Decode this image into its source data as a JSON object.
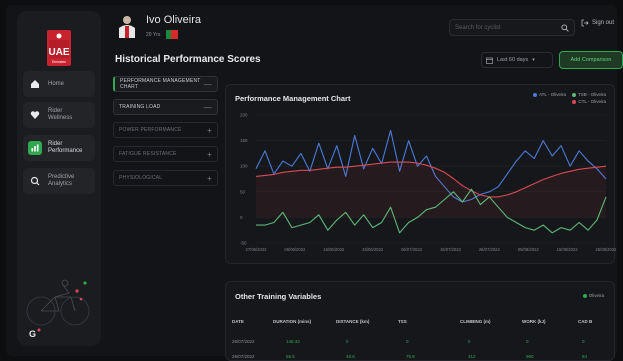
{
  "athlete": {
    "name": "Ivo Oliveira",
    "age": "20 Yrs"
  },
  "search": {
    "placeholder": "Search for cyclist"
  },
  "header": {
    "sign_out": "Sign out"
  },
  "sidebar": {
    "logo_text": "UAE",
    "logo_sub": "Emirates",
    "items": [
      {
        "label": "Home",
        "icon": "home-icon"
      },
      {
        "label": "Rider\nWellness",
        "icon": "heart-icon"
      },
      {
        "label": "Rider\nPerformance",
        "icon": "chart-icon"
      },
      {
        "label": "Predictive\nAnalytics",
        "icon": "analytics-icon"
      }
    ],
    "footer_logo": "G"
  },
  "page": {
    "title": "Historical Performance Scores",
    "range": "Last 60 days",
    "add_button": "Add Comparison"
  },
  "metrics": [
    {
      "label": "PERFORMANCE MANAGEMENT CHART",
      "toggle": "—"
    },
    {
      "label": "TRAINING LOAD",
      "toggle": "—"
    },
    {
      "label": "POWER PERFORMANCE",
      "toggle": "+"
    },
    {
      "label": "FATIGUE RESISTANCE",
      "toggle": "+"
    },
    {
      "label": "PHYSIOLOGICAL",
      "toggle": "+"
    }
  ],
  "chart": {
    "title": "Performance Management Chart",
    "legend": [
      {
        "name": "ATL - Oliveira",
        "color": "#4c7bd9"
      },
      {
        "name": "TSB - Oliveira",
        "color": "#5db87a"
      },
      {
        "name": "CTL - Oliveira",
        "color": "#d94a57"
      }
    ]
  },
  "chart_data": {
    "type": "line",
    "title": "Performance Management Chart",
    "ylim": [
      -50,
      200
    ],
    "yticks": [
      200,
      150,
      100,
      50,
      0,
      -50
    ],
    "x_ticks": [
      "27/05/2022",
      "06/06/2022",
      "16/06/2022",
      "26/06/2022",
      "06/07/2022",
      "16/07/2022",
      "26/07/2022",
      "05/08/2022",
      "15/08/2022",
      "25/08/2022"
    ],
    "series": [
      {
        "name": "ATL - Oliveira",
        "color": "#4c7bd9",
        "values": [
          95,
          130,
          85,
          110,
          100,
          125,
          90,
          145,
          95,
          140,
          80,
          160,
          95,
          135,
          105,
          170,
          90,
          150,
          100,
          120,
          80,
          60,
          40,
          30,
          35,
          45,
          50,
          60,
          85,
          110,
          130,
          115,
          150,
          120,
          140,
          100,
          130,
          110,
          95,
          75
        ]
      },
      {
        "name": "CTL - Oliveira",
        "color": "#d94a57",
        "values": [
          80,
          82,
          84,
          88,
          90,
          92,
          92,
          94,
          96,
          98,
          98,
          100,
          102,
          104,
          106,
          108,
          108,
          108,
          106,
          102,
          96,
          88,
          76,
          62,
          52,
          44,
          40,
          40,
          44,
          50,
          58,
          66,
          74,
          80,
          86,
          90,
          94,
          96,
          98,
          100
        ]
      },
      {
        "name": "TSB - Oliveira",
        "color": "#5db87a",
        "values": [
          -15,
          -15,
          -10,
          10,
          -20,
          -15,
          -10,
          5,
          -25,
          -5,
          10,
          -15,
          5,
          -20,
          -10,
          20,
          -30,
          -10,
          0,
          15,
          20,
          35,
          50,
          30,
          55,
          25,
          40,
          20,
          0,
          -10,
          -20,
          -25,
          -15,
          -30,
          -20,
          -25,
          -10,
          -25,
          -5,
          40
        ]
      }
    ]
  },
  "table": {
    "title": "Other Training Variables",
    "legend": "Oliveira",
    "columns": [
      "DATE",
      "DURATION (mins)",
      "DISTANCE (km)",
      "TSS",
      "CLIMBING (m)",
      "WORK (kJ)",
      "CAD B"
    ],
    "rows": [
      [
        "26/07/2022",
        "148.33",
        "0",
        "0",
        "0",
        "0",
        "0"
      ],
      [
        "26/07/2022",
        "56.5",
        "48.6",
        "75.8",
        "412",
        "960",
        "84"
      ]
    ]
  }
}
